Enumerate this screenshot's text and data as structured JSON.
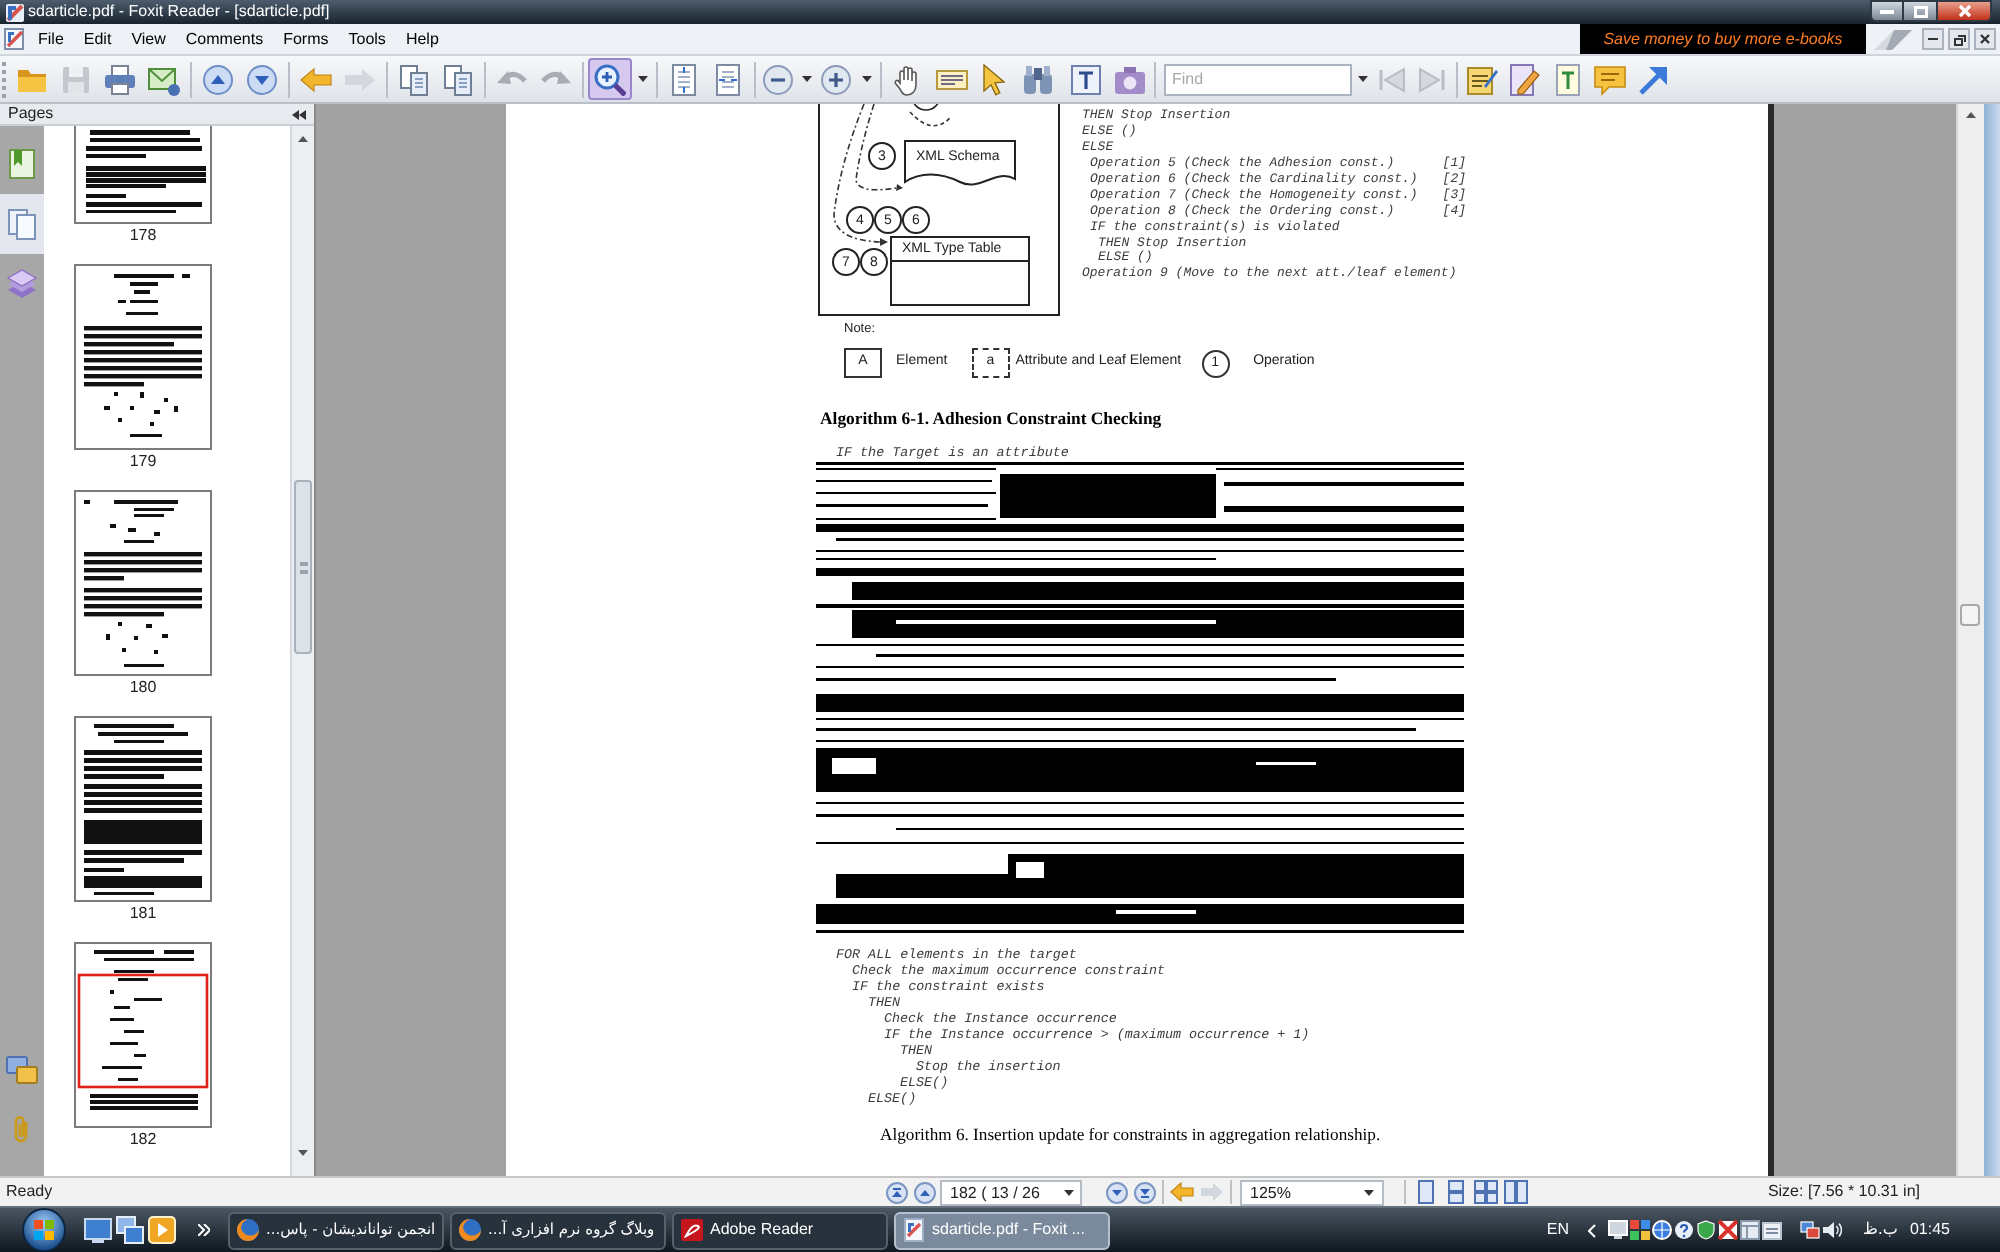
{
  "window": {
    "title": "sdarticle.pdf - Foxit Reader - [sdarticle.pdf]"
  },
  "menu_bar": {
    "items": [
      "File",
      "Edit",
      "View",
      "Comments",
      "Forms",
      "Tools",
      "Help"
    ],
    "banner": "Save money to buy more e-books"
  },
  "toolbar": {
    "zoom_tool": {
      "selected": true
    },
    "find_field": {
      "placeholder": "Find"
    }
  },
  "side_panel": {
    "title": "Pages",
    "tabs": [
      {
        "selected": false
      },
      {
        "selected": true
      },
      {
        "selected": false
      }
    ],
    "thumbnails": [
      {
        "label": "178",
        "selected": false
      },
      {
        "label": "179",
        "selected": false
      },
      {
        "label": "180",
        "selected": false
      },
      {
        "label": "181",
        "selected": false
      },
      {
        "label": "182",
        "selected": true
      }
    ]
  },
  "document": {
    "diagram": {
      "nodes": [
        {
          "kind": "operation",
          "label": "3"
        },
        {
          "kind": "document",
          "label": "XML Schema"
        },
        {
          "kind": "operation",
          "label": "4"
        },
        {
          "kind": "operation",
          "label": "5"
        },
        {
          "kind": "operation",
          "label": "6"
        },
        {
          "kind": "operation",
          "label": "7"
        },
        {
          "kind": "operation",
          "label": "8"
        },
        {
          "kind": "table",
          "label": "XML Type Table"
        }
      ]
    },
    "operations_listing": [
      {
        "text": "THEN Stop Insertion"
      },
      {
        "text": "ELSE ()"
      },
      {
        "text": "ELSE",
        "children": [
          {
            "text": "Operation 5 (Check the Adhesion const.)",
            "ref": "[1]"
          },
          {
            "text": "Operation 6 (Check the Cardinality const.)",
            "ref": "[2]"
          },
          {
            "text": "Operation 7 (Check the Homogeneity const.)",
            "ref": "[3]"
          },
          {
            "text": "Operation 8 (Check the Ordering const.)",
            "ref": "[4]"
          },
          {
            "text": "IF the constraint(s) is violated",
            "children": [
              {
                "text": "THEN Stop Insertion"
              },
              {
                "text": "ELSE ()"
              }
            ]
          }
        ]
      },
      {
        "text": "Operation 9 (Move to the next att./leaf element)"
      }
    ],
    "legend": {
      "title": "Note:",
      "items": [
        {
          "kind": "element",
          "symbol": "A",
          "label": "Element"
        },
        {
          "kind": "attribute",
          "symbol": "a",
          "label": "Attribute and Leaf Element"
        },
        {
          "kind": "operation",
          "symbol": "1",
          "label": "Operation"
        }
      ]
    },
    "algorithm_6_1": {
      "heading": "Algorithm 6-1. Adhesion Constraint Checking",
      "code": [
        {
          "text": "IF the Target is an attribute"
        }
      ]
    },
    "algorithm_6": {
      "code": [
        {
          "text": "FOR ALL elements in the target",
          "children": [
            {
              "text": "Check the maximum occurrence constraint"
            },
            {
              "text": "IF the constraint exists",
              "children": [
                {
                  "text": "THEN",
                  "children": [
                    {
                      "text": "Check the Instance occurrence"
                    },
                    {
                      "text": "IF the Instance occurrence > (maximum occurrence + 1)",
                      "children": [
                        {
                          "text": "THEN",
                          "children": [
                            {
                              "text": "Stop the insertion"
                            }
                          ]
                        },
                        {
                          "text": "ELSE()"
                        }
                      ]
                    }
                  ]
                },
                {
                  "text": "ELSE()"
                }
              ]
            }
          ]
        }
      ],
      "caption": "Algorithm 6. Insertion update for constraints in aggregation relationship."
    }
  },
  "status_bar": {
    "status": "Ready",
    "page_field": {
      "value": "182 ( 13 / 26"
    },
    "zoom_field": {
      "value": "125%"
    },
    "page_size": "Size: [7.56 * 10.31 in]"
  },
  "taskbar": {
    "buttons": [
      {
        "label": "انجمن توانانديشان - پاس...",
        "selected": false
      },
      {
        "label": "وبلاگ گروه نرم افزاری آ...",
        "selected": false
      },
      {
        "label": "Adobe Reader",
        "selected": false
      },
      {
        "label": "sdarticle.pdf - Foxit ...",
        "selected": true
      }
    ],
    "language": "EN",
    "period": "ب.ظ",
    "time": "01:45"
  }
}
